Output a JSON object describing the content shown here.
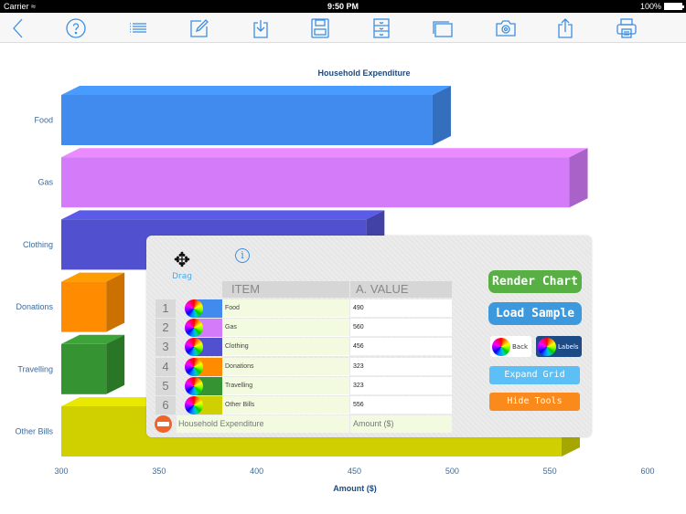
{
  "status_bar": {
    "carrier": "Carrier",
    "time": "9:50 PM",
    "battery": "100%"
  },
  "toolbar": {
    "buttons": [
      {
        "name": "back",
        "icon": "chevron-left-icon"
      },
      {
        "name": "help",
        "icon": "question-circle-icon"
      },
      {
        "name": "list",
        "icon": "list-icon"
      },
      {
        "name": "edit",
        "icon": "pencil-square-icon"
      },
      {
        "name": "import",
        "icon": "download-tray-icon"
      },
      {
        "name": "save",
        "icon": "floppy-disk-icon"
      },
      {
        "name": "file-cabinet",
        "icon": "file-cabinet-icon"
      },
      {
        "name": "windows",
        "icon": "windows-icon"
      },
      {
        "name": "camera",
        "icon": "camera-icon"
      },
      {
        "name": "share",
        "icon": "share-icon"
      },
      {
        "name": "print",
        "icon": "printer-icon"
      }
    ]
  },
  "chart_data": {
    "type": "bar",
    "orientation": "horizontal",
    "style": "3d",
    "title": "Household Expenditure",
    "xlabel": "Amount ($)",
    "ylabel": "",
    "categories": [
      "Food",
      "Gas",
      "Clothing",
      "Donations",
      "Travelling",
      "Other Bills"
    ],
    "values": [
      490,
      560,
      456,
      323,
      323,
      556
    ],
    "colors": [
      "#418bee",
      "#d37bf9",
      "#5151d0",
      "#ff8c00",
      "#359431",
      "#d0cf00"
    ],
    "xlim": [
      300,
      600
    ],
    "xticks": [
      300,
      350,
      400,
      450,
      500,
      550,
      600
    ],
    "grid": false,
    "legend": "none"
  },
  "tools_panel": {
    "drag_label": "Drag",
    "info_icon": "i",
    "columns": {
      "item": "ITEM",
      "value": "A.  VALUE"
    },
    "rows": [
      {
        "num": "1",
        "item": "Food",
        "value": "490",
        "color": "#418bee"
      },
      {
        "num": "2",
        "item": "Gas",
        "value": "560",
        "color": "#d37bf9"
      },
      {
        "num": "3",
        "item": "Clothing",
        "value": "456",
        "color": "#5151d0"
      },
      {
        "num": "4",
        "item": "Donations",
        "value": "323",
        "color": "#ff8c00"
      },
      {
        "num": "5",
        "item": "Travelling",
        "value": "323",
        "color": "#359431"
      },
      {
        "num": "6",
        "item": "Other Bills",
        "value": "556",
        "color": "#d0cf00"
      }
    ],
    "chart_title_field": "Household Expenditure",
    "axis_title_field": "Amount ($)",
    "buttons": {
      "render": "Render Chart",
      "load": "Load Sample",
      "back": "Back",
      "labels": "Labels",
      "expand": "Expand Grid",
      "hide": "Hide Tools"
    }
  }
}
